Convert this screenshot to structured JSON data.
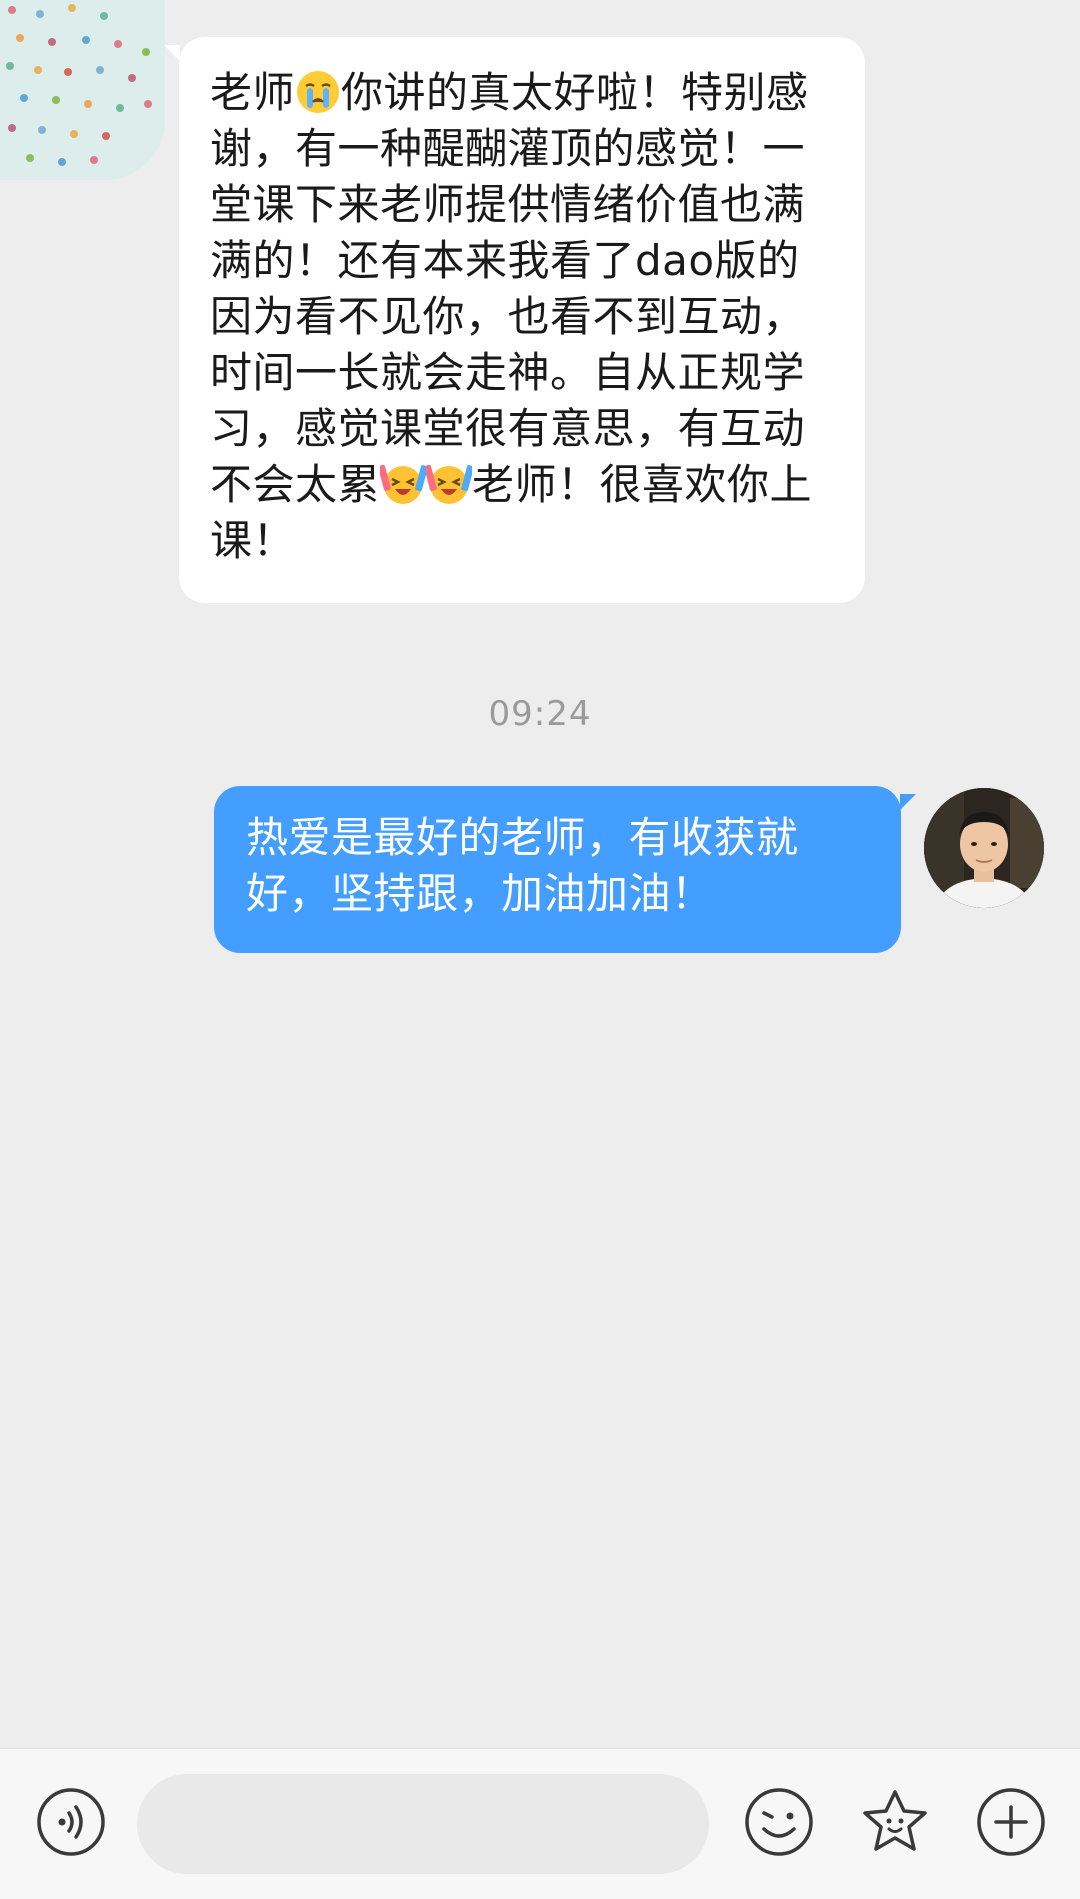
{
  "messages": [
    {
      "sender": "other",
      "parts": [
        {
          "type": "text",
          "value": "老师"
        },
        {
          "type": "emoji",
          "icon": "crying-face-icon"
        },
        {
          "type": "text",
          "value": "你讲的真太好啦！特别感谢，有一种醍醐灌顶的感觉！一堂课下来老师提供情绪价值也满满的！还有本来我看了dao版的 因为看不见你，也看不到互动，时间一长就会走神。自从正规学习，感觉课堂很有意思，有互动不会太累"
        },
        {
          "type": "emoji",
          "icon": "cheering-face-icon"
        },
        {
          "type": "emoji",
          "icon": "cheering-face-icon"
        },
        {
          "type": "text",
          "value": "老师！很喜欢你上课！"
        }
      ]
    },
    {
      "timestamp": "09:24"
    },
    {
      "sender": "self",
      "text": "热爱是最好的老师，有收获就好，坚持跟，加油加油！"
    }
  ],
  "input_bar": {
    "voice_icon": "voice-icon",
    "input_value": "",
    "emoji_icon": "emoji-icon",
    "favorites_icon": "sticker-icon",
    "more_icon": "plus-icon"
  },
  "colors": {
    "background": "#ededed",
    "incoming_bubble": "#ffffff",
    "outgoing_bubble": "#439eff",
    "timestamp": "#9a9a9a"
  }
}
